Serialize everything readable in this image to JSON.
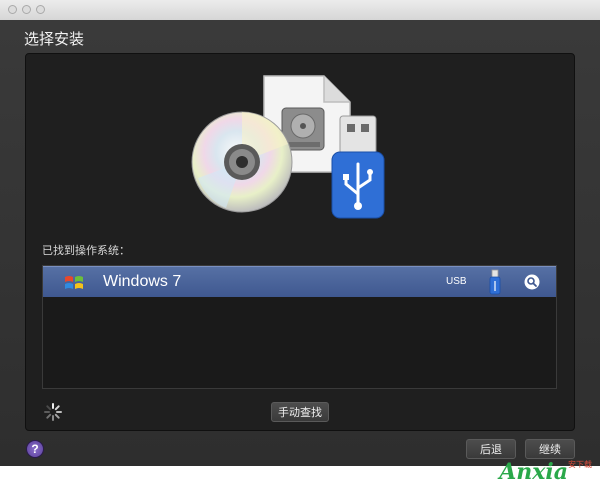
{
  "window": {
    "title": "选择安装"
  },
  "main": {
    "found_label": "已找到操作系统：",
    "os_list": [
      {
        "name": "Windows 7",
        "source": "USB",
        "icon": "windows-logo-icon"
      }
    ],
    "manual_button": "手动查找"
  },
  "footer": {
    "help": "?",
    "back_button": "后退",
    "continue_button": "继续"
  },
  "watermark": {
    "text": "Anxia",
    "sub": "安下载"
  },
  "colors": {
    "selection": "#4a64a0",
    "panel": "#1f1f1f",
    "usb_blue": "#2f6fd6"
  }
}
